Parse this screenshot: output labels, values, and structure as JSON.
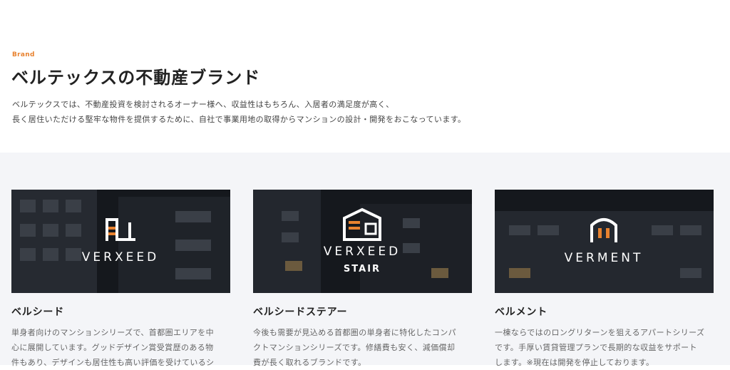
{
  "header": {
    "eyebrow": "Brand",
    "title": "ベルテックスの不動産ブランド",
    "desc_line1": "ベルテックスでは、不動産投資を検討されるオーナー様へ、収益性はもちろん、入居者の満足度が高く、",
    "desc_line2": "長く居住いただける堅牢な物件を提供するために、自社で事業用地の取得からマンションの設計・開発をおこなっています。"
  },
  "cards": [
    {
      "logo_text": "VERXEED",
      "logo_sub": "",
      "name": "ベルシード",
      "text": [
        "単身者向けのマンションシリーズで、首都圏エリアを中",
        "心に展開しています。グッドデザイン賞受賞歴のある物",
        "件もあり、デザインも居住性も高い評価を受けているシ"
      ]
    },
    {
      "logo_text": "VERXEED",
      "logo_sub": "STAIR",
      "name": "ベルシードステアー",
      "text": [
        "今後も需要が見込める首都圏の単身者に特化したコンパ",
        "クトマンションシリーズです。修繕費も安く、減価償却",
        "費が長く取れるブランドです。"
      ]
    },
    {
      "logo_text": "VERMENT",
      "logo_sub": "",
      "name": "ベルメント",
      "text": [
        "一棟ならではのロングリターンを狙えるアパートシリーズ",
        "です。手厚い賃貸管理プランで長期的な収益をサポート",
        "します。※現在は開発を停止しております。"
      ]
    }
  ],
  "colors": {
    "accent": "#e8822f",
    "band_bg": "#f4f5f8",
    "image_bg": "#15181d"
  }
}
